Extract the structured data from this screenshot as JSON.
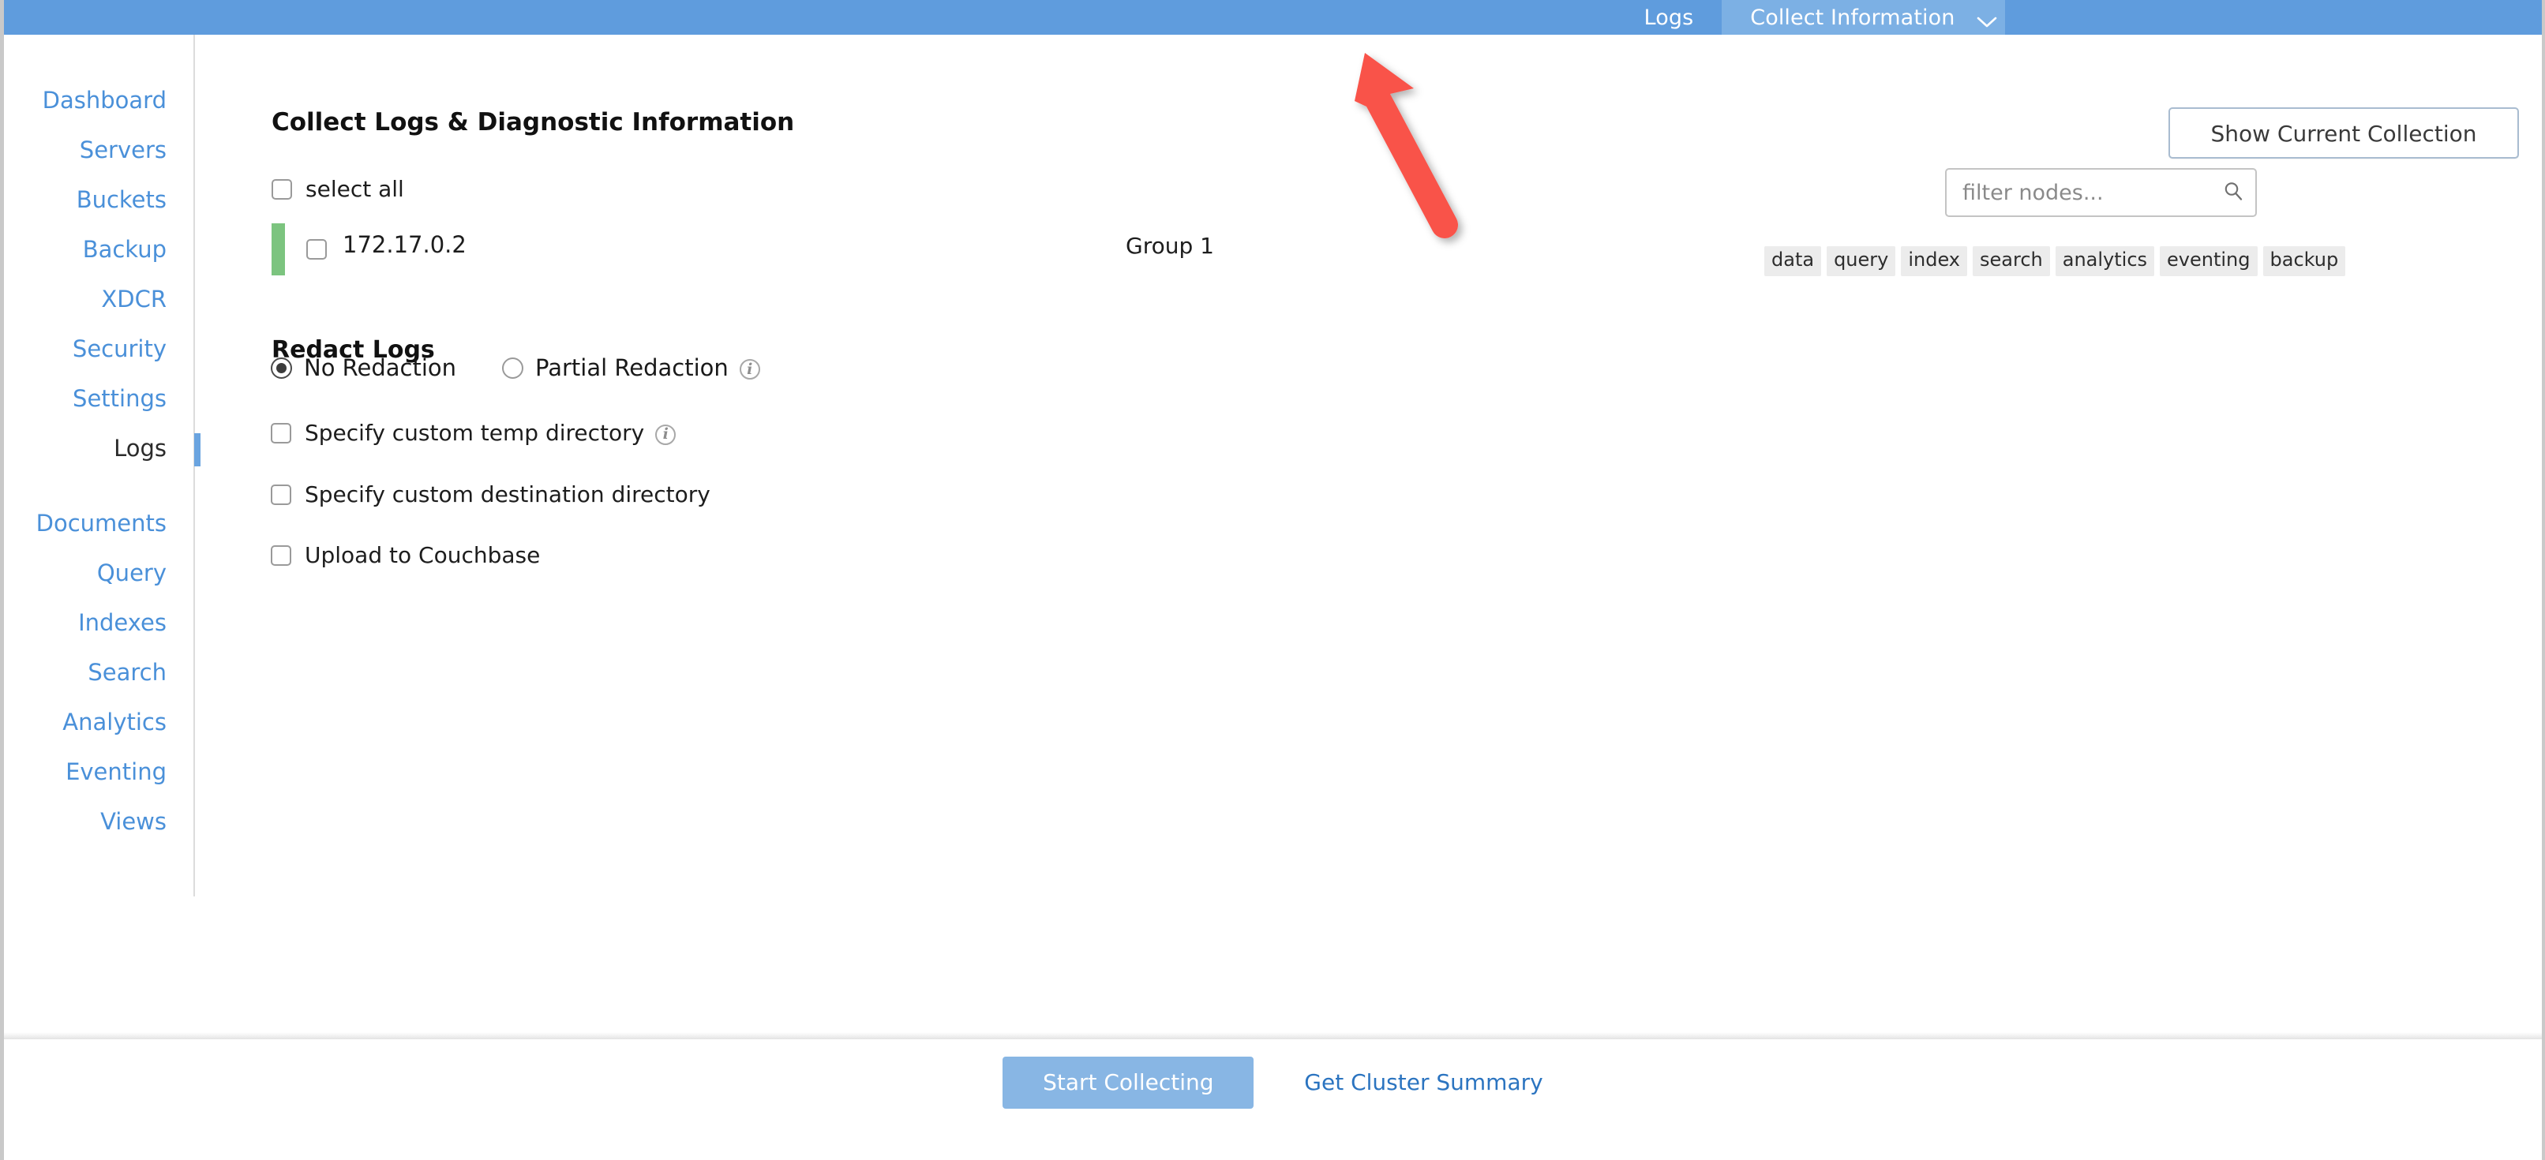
{
  "header": {
    "tabs": [
      {
        "label": "Logs",
        "active": false,
        "icon": null
      },
      {
        "label": "Collect Information",
        "active": true,
        "icon": "chevron-down-icon"
      }
    ],
    "background_color": "#5f9cdd",
    "active_tab_color": "#7cb0e4"
  },
  "sidebar": {
    "items": [
      {
        "label": "Dashboard",
        "active": false
      },
      {
        "label": "Servers",
        "active": false
      },
      {
        "label": "Buckets",
        "active": false
      },
      {
        "label": "Backup",
        "active": false
      },
      {
        "label": "XDCR",
        "active": false
      },
      {
        "label": "Security",
        "active": false
      },
      {
        "label": "Settings",
        "active": false
      },
      {
        "label": "Logs",
        "active": true
      },
      {
        "label": "Documents",
        "active": false
      },
      {
        "label": "Query",
        "active": false
      },
      {
        "label": "Indexes",
        "active": false
      },
      {
        "label": "Search",
        "active": false
      },
      {
        "label": "Analytics",
        "active": false
      },
      {
        "label": "Eventing",
        "active": false
      },
      {
        "label": "Views",
        "active": false
      }
    ],
    "link_color": "#4a90d9",
    "active_color": "#2b2b2b",
    "active_indicator_color": "#6aa4e0"
  },
  "main": {
    "page_title": "Collect Logs & Diagnostic Information",
    "show_current_collection_label": "Show Current Collection",
    "select_all_label": "select all",
    "nodes": [
      {
        "name": "172.17.0.2",
        "group": "Group 1",
        "status_color": "#7cc47f",
        "checked": false
      }
    ],
    "filter": {
      "placeholder": "filter nodes...",
      "value": "",
      "icon": "search-icon"
    },
    "service_badges": [
      "data",
      "query",
      "index",
      "search",
      "analytics",
      "eventing",
      "backup"
    ],
    "redact": {
      "title": "Redact Logs",
      "options": [
        {
          "label": "No Redaction",
          "selected": true,
          "info": false
        },
        {
          "label": "Partial Redaction",
          "selected": false,
          "info": true
        }
      ]
    },
    "checkboxes": [
      {
        "label": "Specify custom temp directory",
        "checked": false,
        "info": true
      },
      {
        "label": "Specify custom destination directory",
        "checked": false,
        "info": false
      },
      {
        "label": "Upload to Couchbase",
        "checked": false,
        "info": false
      }
    ],
    "info_icon_glyph": "i"
  },
  "footer": {
    "start_collecting_label": "Start Collecting",
    "start_collecting_color": "#88b6e4",
    "get_cluster_summary_label": "Get Cluster Summary",
    "link_color": "#2b74c0"
  },
  "annotation": {
    "type": "arrow",
    "color": "#f9524a",
    "points_to": "Collect Information"
  }
}
